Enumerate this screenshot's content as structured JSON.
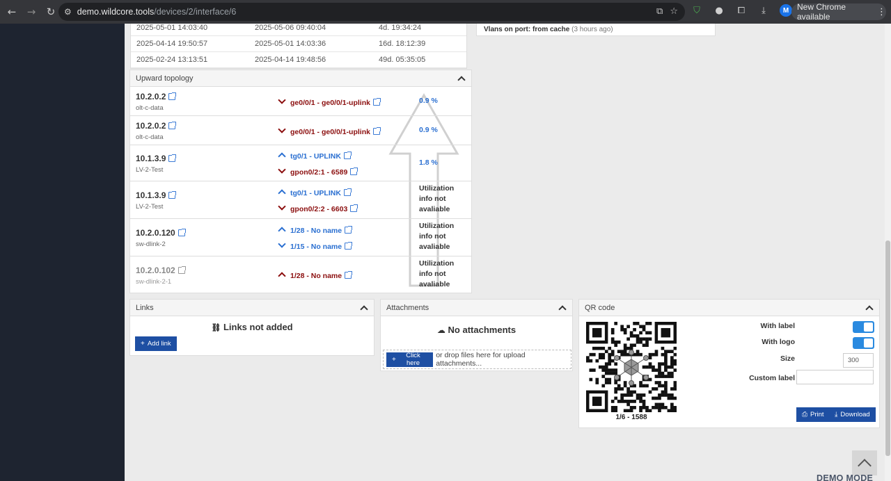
{
  "browser": {
    "url_host": "demo.wildcore.tools",
    "url_path": "/devices/2/interface/6",
    "update_label": "New Chrome available",
    "profile_initial": "M"
  },
  "history": {
    "rows": [
      [
        "2025-05-01 14:03:40",
        "2025-05-06 09:40:04",
        "4d. 19:34:24"
      ],
      [
        "2025-04-14 19:50:57",
        "2025-05-01 14:03:36",
        "16d. 18:12:39"
      ],
      [
        "2025-02-24 13:13:51",
        "2025-04-14 19:48:56",
        "49d. 05:35:05"
      ]
    ]
  },
  "vlans": {
    "label": "Vlans on port: from cache",
    "age": "(3 hours ago)"
  },
  "topology": {
    "title": "Upward topology",
    "rows": [
      {
        "ip": "10.2.0.2",
        "name": "olt-c-data",
        "ports": [
          {
            "dir": "down",
            "label": "ge0/0/1 - ge0/0/1-uplink"
          }
        ],
        "util": "0.9 %"
      },
      {
        "ip": "10.2.0.2",
        "name": "olt-c-data",
        "ports": [
          {
            "dir": "down",
            "label": "ge0/0/1 - ge0/0/1-uplink"
          }
        ],
        "util": "0.9 %"
      },
      {
        "ip": "10.1.3.9",
        "name": "LV-2-Test",
        "ports": [
          {
            "dir": "up",
            "label": "tg0/1 - UPLINK"
          },
          {
            "dir": "down",
            "label": "gpon0/2:1 - 6589"
          }
        ],
        "util": "1.8 %"
      },
      {
        "ip": "10.1.3.9",
        "name": "LV-2-Test",
        "ports": [
          {
            "dir": "up",
            "label": "tg0/1 - UPLINK"
          },
          {
            "dir": "down",
            "label": "gpon0/2:2 - 6603"
          }
        ],
        "util": "Utilization info not avaliable"
      },
      {
        "ip": "10.2.0.120",
        "name": "sw-dlink-2",
        "ports": [
          {
            "dir": "up",
            "label": "1/28 - No name"
          },
          {
            "dir": "down",
            "label": "1/15 - No name"
          }
        ],
        "util": "Utilization info not avaliable"
      },
      {
        "ip": "10.2.0.102",
        "name": "sw-dlink-2-1",
        "ports": [
          {
            "dir": "up",
            "label": "1/28 - No name"
          }
        ],
        "util": "Utilization info not avaliable"
      }
    ]
  },
  "links": {
    "title": "Links",
    "empty": "Links not added",
    "add_button": "Add link"
  },
  "attachments": {
    "title": "Attachments",
    "empty": "No attachments",
    "click_button": "Click here",
    "drop_text": "or drop files here for upload attachments..."
  },
  "qr": {
    "title": "QR code",
    "caption": "1/6 - 1588",
    "with_label": "With label",
    "with_logo": "With logo",
    "size_label": "Size",
    "size_value": "300",
    "custom_label": "Custom label",
    "custom_value": "",
    "print_button": "Print",
    "download_button": "Download"
  },
  "footer": {
    "demo_mode": "DEMO MODE"
  },
  "colors": {
    "down_port": "#8b0e0e",
    "up_port": "#2a6fd1",
    "primary_button": "#1e4fa3",
    "toggle_on": "#2a8ae0",
    "sidebar": "#1e2430"
  }
}
